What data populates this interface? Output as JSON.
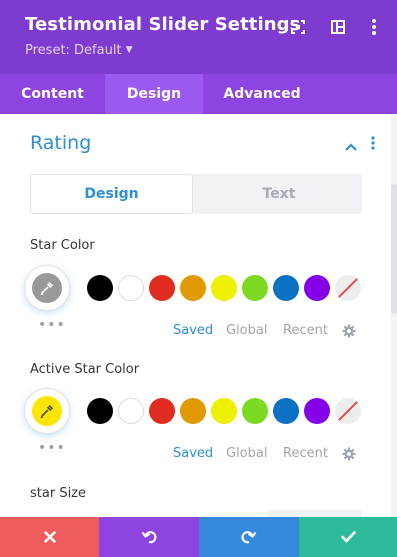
{
  "header": {
    "title": "Testimonial Slider Settings",
    "preset": "Preset: Default",
    "icons": [
      "focus-icon",
      "split-view-icon",
      "more-vertical-icon"
    ]
  },
  "tabs": [
    {
      "label": "Content",
      "active": false
    },
    {
      "label": "Design",
      "active": true
    },
    {
      "label": "Advanced",
      "active": false
    }
  ],
  "section": {
    "title": "Rating",
    "subtabs": [
      {
        "label": "Design",
        "active": true
      },
      {
        "label": "Text",
        "active": false
      }
    ]
  },
  "star_color": {
    "label": "Star Color",
    "current": "#999999",
    "more": "•••"
  },
  "active_star_color": {
    "label": "Active Star Color",
    "current": "#ffe500",
    "more": "•••"
  },
  "palette": [
    "#000000",
    "#ffffff",
    "#e02b20",
    "#e09900",
    "#edf000",
    "#7cda24",
    "#0c71c3",
    "#8300e9",
    "none"
  ],
  "palette_tabs": [
    {
      "label": "Saved",
      "active": true
    },
    {
      "label": "Global",
      "active": false
    },
    {
      "label": "Recent",
      "active": false
    }
  ],
  "star_size": {
    "label": "star Size"
  },
  "footer": {
    "buttons": [
      {
        "name": "discard",
        "icon": "close-icon",
        "color": "#ee5c5c"
      },
      {
        "name": "undo",
        "icon": "undo-icon",
        "color": "#8e44e0"
      },
      {
        "name": "redo",
        "icon": "redo-icon",
        "color": "#3589dd"
      },
      {
        "name": "save",
        "icon": "check-icon",
        "color": "#2ebb9c"
      }
    ]
  },
  "colors": {
    "header_bg": "#7d3bcf",
    "tabs_bg": "#8e44e0",
    "accent": "#2d8fd6"
  }
}
